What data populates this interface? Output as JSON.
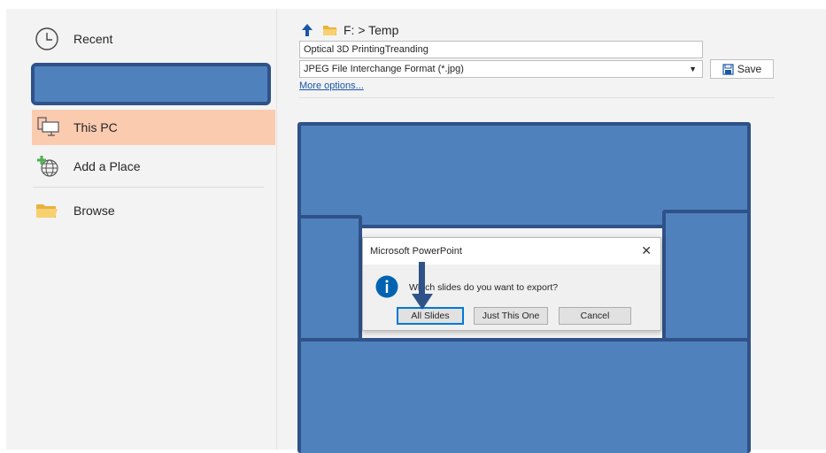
{
  "nav": {
    "recent_label": "Recent",
    "this_pc_label": "This PC",
    "add_place_label": "Add a Place",
    "browse_label": "Browse"
  },
  "location": {
    "path": "F: > Temp"
  },
  "save_form": {
    "file_name": "Optical 3D PrintingTreanding",
    "file_type": "JPEG File Interchange Format (*.jpg)",
    "save_label": "Save",
    "more_options": "More options..."
  },
  "dialog": {
    "title": "Microsoft PowerPoint",
    "message": "Which slides do you want to export?",
    "buttons": {
      "all": "All Slides",
      "one": "Just This One",
      "cancel": "Cancel"
    }
  },
  "colors": {
    "highlight": "#fbcbb0",
    "redaction_fill": "#4f81bd",
    "redaction_border": "#2f5288",
    "link": "#1a56a8",
    "info_icon": "#0063b1"
  },
  "icons": [
    "clock-icon",
    "computer-icon",
    "globe-plus-icon",
    "folder-icon",
    "up-arrow-icon",
    "save-icon",
    "info-icon",
    "close-icon",
    "chevron-down-icon",
    "annotation-arrow-icon"
  ]
}
